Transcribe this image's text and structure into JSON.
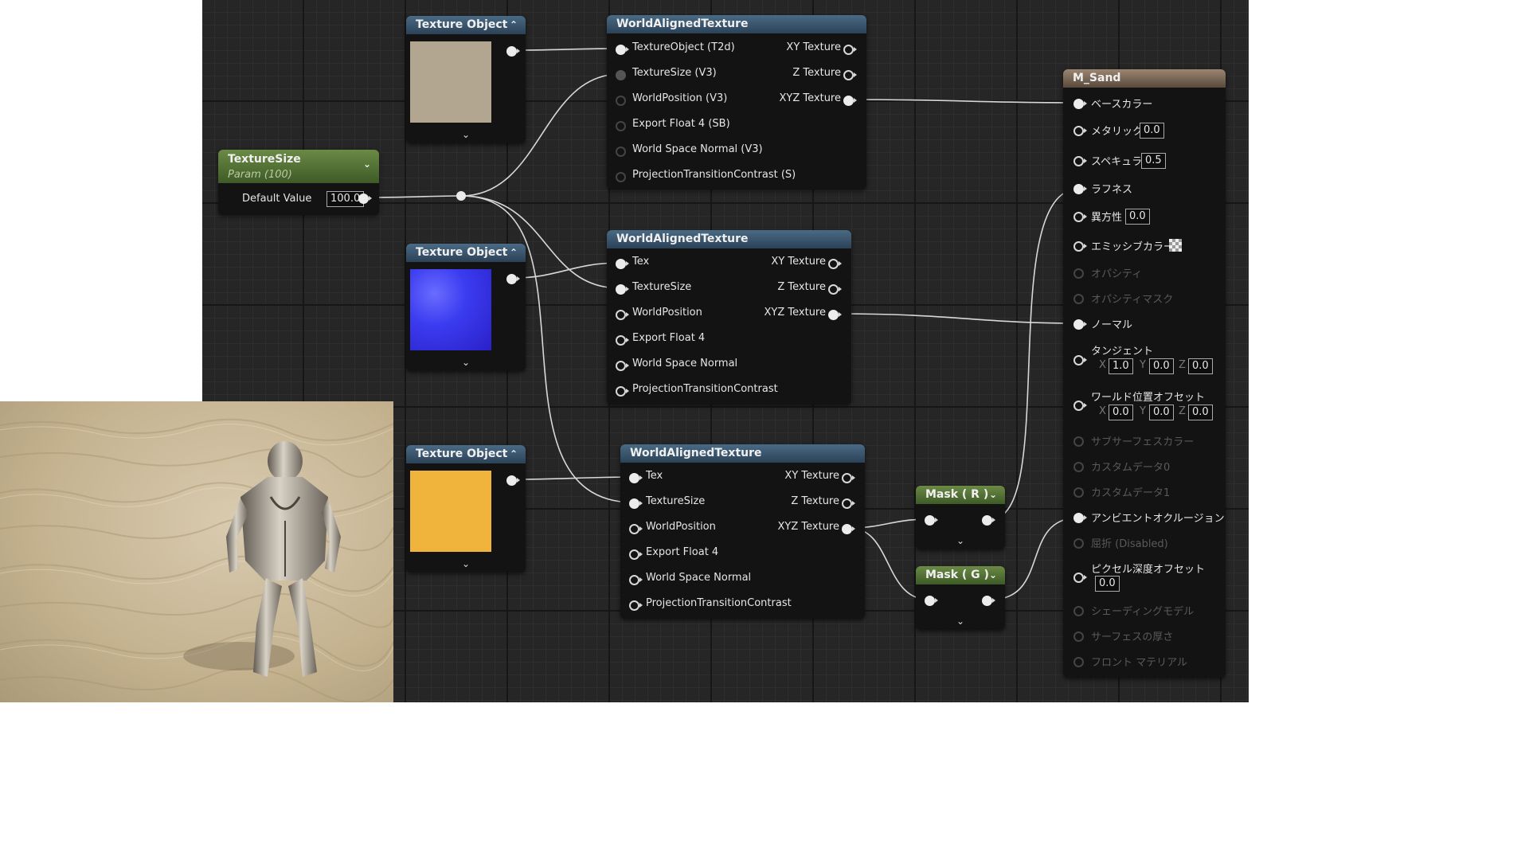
{
  "texture_size_node": {
    "title": "TextureSize",
    "subtitle": "Param (100)",
    "row_label": "Default Value",
    "value": "100.0"
  },
  "texture_objects": [
    {
      "title": "Texture Object"
    },
    {
      "title": "Texture Object"
    },
    {
      "title": "Texture Object"
    }
  ],
  "wat1": {
    "title": "WorldAlignedTexture",
    "inputs": [
      "TextureObject (T2d)",
      "TextureSize (V3)",
      "WorldPosition (V3)",
      "Export Float 4 (SB)",
      "World Space Normal (V3)",
      "ProjectionTransitionContrast (S)"
    ],
    "outputs": [
      "XY Texture",
      "Z Texture",
      "XYZ Texture"
    ]
  },
  "wat2": {
    "title": "WorldAlignedTexture",
    "inputs": [
      "Tex",
      "TextureSize",
      "WorldPosition",
      "Export Float 4",
      "World Space Normal",
      "ProjectionTransitionContrast"
    ],
    "outputs": [
      "XY Texture",
      "Z Texture",
      "XYZ Texture"
    ]
  },
  "wat3": {
    "title": "WorldAlignedTexture",
    "inputs": [
      "Tex",
      "TextureSize",
      "WorldPosition",
      "Export Float 4",
      "World Space Normal",
      "ProjectionTransitionContrast"
    ],
    "outputs": [
      "XY Texture",
      "Z Texture",
      "XYZ Texture"
    ]
  },
  "mask_r": {
    "title": "Mask ( R )"
  },
  "mask_g": {
    "title": "Mask ( G )"
  },
  "material": {
    "title": "M_Sand",
    "base_color": "ベースカラー",
    "metallic": "メタリック",
    "metallic_value": "0.0",
    "specular": "スペキュラ",
    "specular_value": "0.5",
    "roughness": "ラフネス",
    "anisotropy": "異方性",
    "anisotropy_value": "0.0",
    "emissive": "エミッシブカラー",
    "opacity": "オパシティ",
    "opacity_mask": "オパシティマスク",
    "normal": "ノーマル",
    "tangent": "タンジェント",
    "tangent_x": "1.0",
    "tangent_y": "0.0",
    "tangent_z": "0.0",
    "wpo": "ワールド位置オフセット",
    "wpo_x": "0.0",
    "wpo_y": "0.0",
    "wpo_z": "0.0",
    "subsurface": "サブサーフェスカラー",
    "custom0": "カスタムデータ0",
    "custom1": "カスタムデータ1",
    "ao": "アンビエントオクルージョン",
    "refraction": "屈折 (Disabled)",
    "pixel_depth": "ピクセル深度オフセット",
    "pixel_depth_value": "0.0",
    "shading_model": "シェーディングモデル",
    "surface_thickness": "サーフェスの厚さ",
    "front_material": "フロント マテリアル",
    "axis_x": "X",
    "axis_y": "Y",
    "axis_z": "Z"
  },
  "colors": {
    "sand_swatch": "#b3a690",
    "normal_swatch": "#3b3cf0",
    "yellow_swatch": "#f0b43c",
    "wire": "#d8d8d8"
  }
}
